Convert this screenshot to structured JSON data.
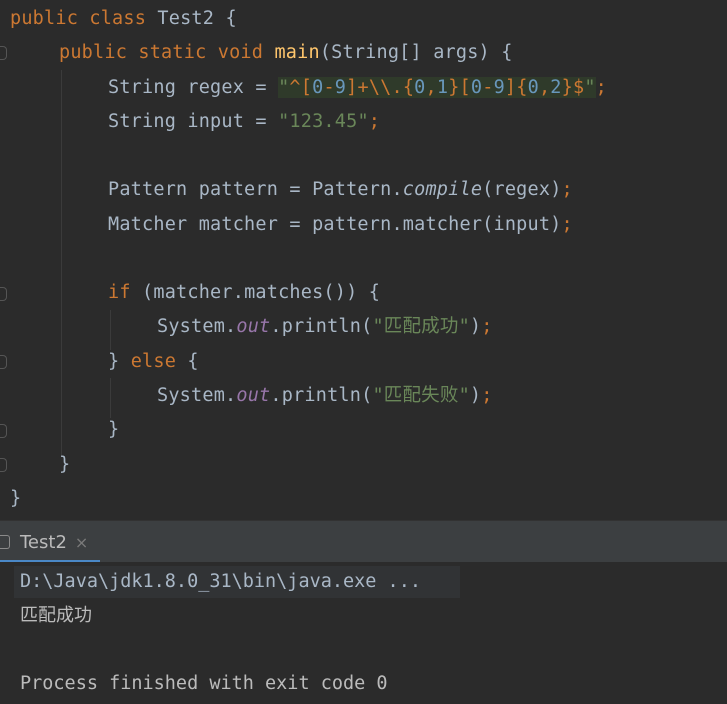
{
  "editor": {
    "lines": {
      "l1": {
        "kw1": "public",
        "kw2": "class",
        "name": "Test2",
        "brace": " {"
      },
      "l2": {
        "kw1": "public",
        "kw2": "static",
        "kw3": "void",
        "fn": "main",
        "rest": "(String[] args) {"
      },
      "l3": {
        "type": "String regex = ",
        "q1": "\"",
        "r1": "^[",
        "r2": "0",
        "r3": "-",
        "r4": "9",
        "r5": "]+\\\\.{",
        "r6": "0",
        "r7": ",",
        "r8": "1",
        "r9": "}[",
        "r10": "0",
        "r11": "-",
        "r12": "9",
        "r13": "]{",
        "r14": "0",
        "r15": ",",
        "r16": "2",
        "r17": "}$",
        "q2": "\"",
        "semi": ";"
      },
      "l4": {
        "type": "String input = ",
        "str": "\"123.45\"",
        "semi": ";"
      },
      "l6": {
        "a": "Pattern pattern = Pattern.",
        "m": "compile",
        "b": "(regex)",
        "semi": ";"
      },
      "l7": {
        "a": "Matcher matcher = pattern.matcher(input)",
        "semi": ";"
      },
      "l9": {
        "kw": "if",
        "rest": " (matcher.matches()) {"
      },
      "l10": {
        "a": "System.",
        "field": "out",
        "b": ".println(",
        "str": "\"匹配成功\"",
        "c": ")",
        "semi": ";"
      },
      "l11": {
        "a": "} ",
        "kw": "else",
        "b": " {"
      },
      "l12": {
        "a": "System.",
        "field": "out",
        "b": ".println(",
        "str": "\"匹配失败\"",
        "c": ")",
        "semi": ";"
      },
      "l13": {
        "a": "}"
      },
      "l14": {
        "a": "}"
      },
      "l15": {
        "a": "}"
      }
    }
  },
  "console": {
    "tab_label": "Test2",
    "tab_close": "×",
    "command": "D:\\Java\\jdk1.8.0_31\\bin\\java.exe ...",
    "output_line": "匹配成功",
    "exit_message": "Process finished with exit code 0"
  }
}
